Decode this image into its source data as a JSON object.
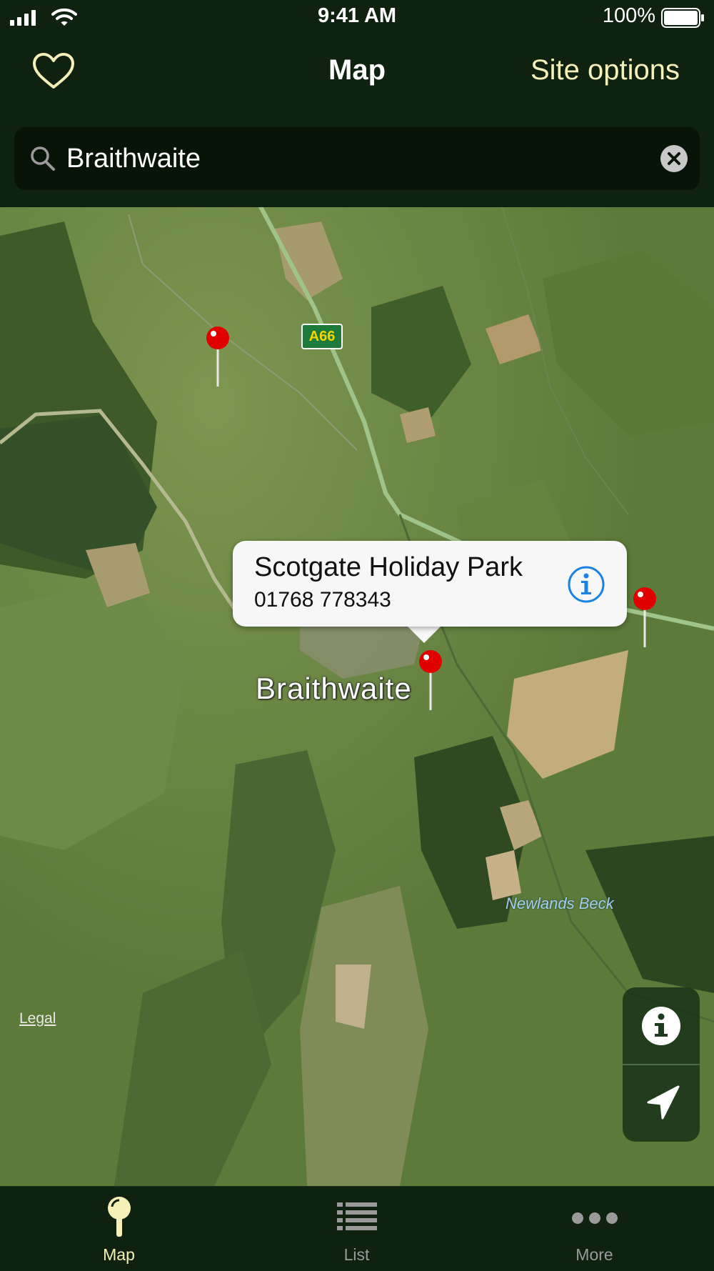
{
  "status_bar": {
    "time": "9:41 AM",
    "battery_percent": "100%"
  },
  "nav": {
    "title": "Map",
    "right_button": "Site options",
    "left_icon": "heart-icon"
  },
  "search": {
    "value": "Braithwaite",
    "icon": "search-icon",
    "clear_icon": "clear-circle-icon"
  },
  "map": {
    "road_label": "A66",
    "town_label": "Braithwaite",
    "river_label": "Newlands Beck",
    "legal_label": "Legal",
    "callout": {
      "title": "Scotgate Holiday Park",
      "phone": "01768 778343",
      "info_icon": "info-circle-icon"
    },
    "controls": [
      "info-icon",
      "location-arrow-icon"
    ]
  },
  "tabs": [
    {
      "label": "Map",
      "icon": "pin-icon",
      "active": true
    },
    {
      "label": "List",
      "icon": "list-icon",
      "active": false
    },
    {
      "label": "More",
      "icon": "ellipsis-icon",
      "active": false
    }
  ],
  "colors": {
    "bar_bg": "#0f2210",
    "accent": "#f5efb8",
    "pin_red": "#e00000",
    "info_blue": "#1a82e2"
  }
}
